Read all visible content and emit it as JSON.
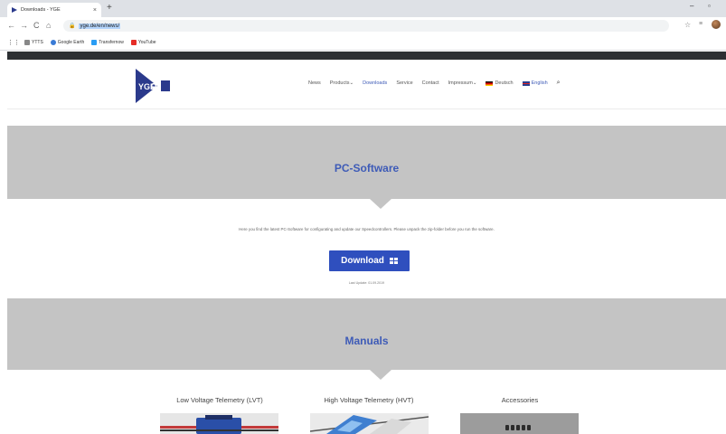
{
  "browser": {
    "tab_title": "Downloads - YGE",
    "tab_close": "×",
    "new_tab": "+",
    "win_min": "–",
    "win_max": "▫",
    "nav_back": "←",
    "nav_forward": "→",
    "nav_reload": "C",
    "nav_home": "⌂",
    "url": "yge.de/en/news/",
    "bookmark_star": "☆",
    "menu_icon": "≡",
    "bookmarks": [
      {
        "label": "YTTS",
        "color": "#888888"
      },
      {
        "label": "Google Earth",
        "color": "#3a7bd5"
      },
      {
        "label": "Transfernow",
        "color": "#2a9df4"
      },
      {
        "label": "YouTube",
        "color": "#e52d27"
      }
    ]
  },
  "site": {
    "logo_text": "YGE",
    "nav": {
      "news": "News",
      "products": "Products",
      "downloads": "Downloads",
      "service": "Service",
      "contact": "Contact",
      "impressum": "Impressum",
      "deutsch": "Deutsch",
      "english": "English",
      "dropdown_suffix": " ⌄",
      "search_icon": "🔍"
    },
    "accent_color": "#3e5bb7",
    "pc_software": {
      "title": "PC-Software",
      "intro": "Here you find the latest PC-Software for configurating and update our Speedcontrollers. Please unpack the zip-folder before you run the software.",
      "download_label": "Download",
      "last_update": "Last Update: 01.09.2019"
    },
    "manuals": {
      "title": "Manuals",
      "columns": [
        {
          "title": "Low Voltage Telemetry (LVT)"
        },
        {
          "title": "High Voltage Telemetry (HVT)"
        },
        {
          "title": "Accessories"
        }
      ]
    }
  }
}
